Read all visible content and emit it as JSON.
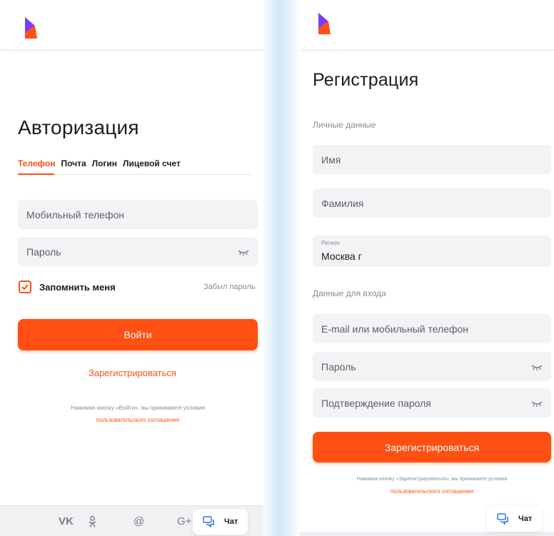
{
  "colors": {
    "accent": "#ff4f12",
    "logo_top": "#7b3ff2",
    "logo_bottom": "#ff4f12",
    "field_bg": "#f2f3f5",
    "muted_text": "#8b8c94"
  },
  "login": {
    "title": "Авторизация",
    "tabs": [
      {
        "label": "Телефон",
        "active": true
      },
      {
        "label": "Почта",
        "active": false
      },
      {
        "label": "Логин",
        "active": false
      },
      {
        "label": "Лицевой счет",
        "active": false
      }
    ],
    "phone_placeholder": "Мобильный телефон",
    "password_placeholder": "Пароль",
    "remember_label": "Запомнить меня",
    "remember_checked": true,
    "forgot_label": "Забыл пароль",
    "submit_label": "Войти",
    "register_link": "Зарегистрироваться",
    "terms_note": "Нажимая кнопку «Войти», вы принимаете условия",
    "terms_link": "пользовательского соглашения",
    "social_icons": [
      "vk-icon",
      "odnoklassniki-icon",
      "email-at-icon",
      "google-plus-icon"
    ],
    "social_labels": [
      "VK",
      "ok",
      "@",
      "G+"
    ],
    "chat_label": "Чат"
  },
  "register": {
    "title": "Регистрация",
    "personal_section": "Личные данные",
    "first_name_placeholder": "Имя",
    "last_name_placeholder": "Фамилия",
    "region_label": "Регион",
    "region_value": "Москва г",
    "login_section": "Данные для входа",
    "contact_placeholder": "E-mail или мобильный телефон",
    "password_placeholder": "Пароль",
    "password_confirm_placeholder": "Подтверждение пароля",
    "submit_label": "Зарегистрироваться",
    "terms_note": "Нажимая кнопку «Зарегистрироваться», вы принимаете условия",
    "terms_link": "пользовательского соглашения",
    "chat_label": "Чат"
  }
}
